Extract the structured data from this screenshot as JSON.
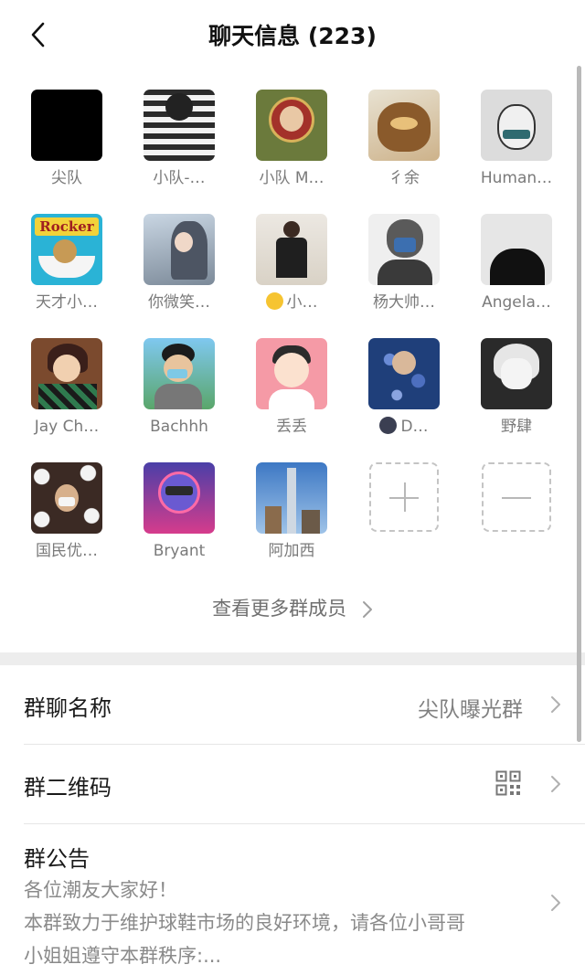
{
  "header": {
    "title": "聊天信息 (223)",
    "back_icon": "chevron-left-icon"
  },
  "members": [
    {
      "name": "尖队"
    },
    {
      "name": "小队-…"
    },
    {
      "name": "小队 M…"
    },
    {
      "name": "彳余"
    },
    {
      "name": "Human…"
    },
    {
      "name": "天才小…"
    },
    {
      "name": "你微笑…"
    },
    {
      "name": "小…",
      "emoji": "winking-face-emoji"
    },
    {
      "name": "杨大帅…"
    },
    {
      "name": "Angela…"
    },
    {
      "name": "Jay Ch…"
    },
    {
      "name": "Bachhh"
    },
    {
      "name": "丢丢"
    },
    {
      "name": "D…",
      "emoji": "new-moon-face-emoji"
    },
    {
      "name": "野肆"
    },
    {
      "name": "国民优…"
    },
    {
      "name": "Bryant"
    },
    {
      "name": "阿加西"
    }
  ],
  "add_member_icon": "plus-icon",
  "remove_member_icon": "minus-icon",
  "more_members": {
    "label": "查看更多群成员"
  },
  "settings": {
    "group_name": {
      "label": "群聊名称",
      "value": "尖队曝光群"
    },
    "group_qr": {
      "label": "群二维码",
      "icon": "qr-code-icon"
    },
    "announcement": {
      "label": "群公告",
      "lines": [
        "各位潮友大家好！",
        "本群致力于维护球鞋市场的良好环境，请各位小哥哥",
        "小姐姐遵守本群秩序:..."
      ]
    }
  },
  "colors": {
    "accent_bg": "#ededed",
    "text_secondary": "#7a7a7a"
  }
}
